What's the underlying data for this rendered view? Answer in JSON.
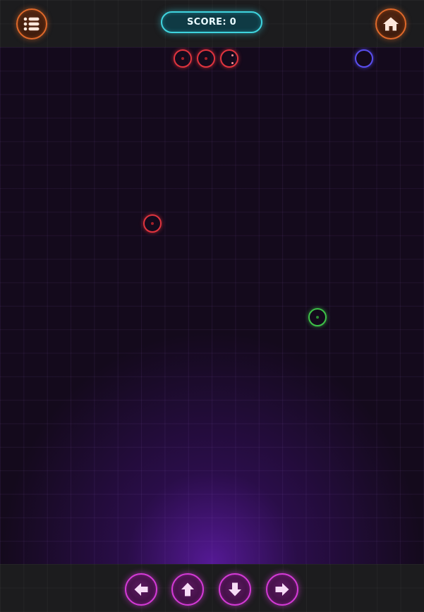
{
  "header": {
    "score_label": "SCORE: 0",
    "menu_icon": "list-icon",
    "home_icon": "home-icon"
  },
  "colors": {
    "accent_orange": "#e0692a",
    "score_cyan": "#3fd4de",
    "snake_red": "#e0343e",
    "food_blue": "#5a4ef0",
    "food_green": "#3ec248",
    "control_magenta": "#d43ad6"
  },
  "game": {
    "grid_columns": 18,
    "grid_rows": 22,
    "snake_color": "red",
    "snake_segments": 3,
    "pickups": [
      {
        "color": "blue"
      },
      {
        "color": "red"
      },
      {
        "color": "green"
      }
    ]
  },
  "controls": {
    "left_icon": "arrow-left-icon",
    "up_icon": "arrow-up-icon",
    "down_icon": "arrow-down-icon",
    "right_icon": "arrow-right-icon"
  }
}
